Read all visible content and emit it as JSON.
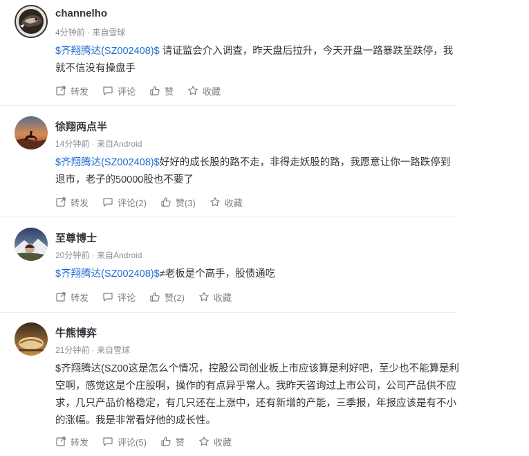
{
  "posts": [
    {
      "username": "channelho",
      "time": "4分钟前",
      "source": "来自雪球",
      "stock": "$齐翔腾达(SZ002408)$",
      "text": " 请证监会介入调查，昨天盘后拉升，今天开盘一路暴跌至跌停，我就不信没有操盘手",
      "forward": "转发",
      "comment": "评论",
      "like": "赞",
      "fav": "收藏"
    },
    {
      "username": "徐翔两点半",
      "time": "14分钟前",
      "source": "来自Android",
      "stock": "$齐翔腾达(SZ002408)$",
      "text": "好好的成长股的路不走，非得走妖股的路，我愿意让你一路跌停到退市，老子的50000股也不要了",
      "forward": "转发",
      "comment": "评论(2)",
      "like": "赞(3)",
      "fav": "收藏"
    },
    {
      "username": "至尊博士",
      "time": "20分钟前",
      "source": "来自Android",
      "stock": "$齐翔腾达(SZ002408)$",
      "text": "≠老板是个高手，股债通吃",
      "forward": "转发",
      "comment": "评论",
      "like": "赞(2)",
      "fav": "收藏"
    },
    {
      "username": "牛熊博弈",
      "time": "21分钟前",
      "source": "来自雪球",
      "stock": "",
      "text": "$齐翔腾达(SZ00这是怎么个情况，控股公司创业板上市应该算是利好吧，至少也不能算是利空啊，感觉这是个庄股啊，操作的有点异乎常人。我昨天咨询过上市公司，公司产品供不应求，几只产品价格稳定，有几只还在上涨中，还有新增的产能，三季报，年报应该是有不小的涨幅。我是非常看好他的成长性。",
      "forward": "转发",
      "comment": "评论(5)",
      "like": "赞",
      "fav": "收藏"
    }
  ],
  "meta_separator": " · ",
  "colors": {
    "link": "#1f6bd1",
    "meta": "#888f99",
    "text": "#33353c",
    "divider": "#ececec"
  },
  "icons": [
    "forward-icon",
    "comment-icon",
    "like-icon",
    "favorite-icon"
  ]
}
